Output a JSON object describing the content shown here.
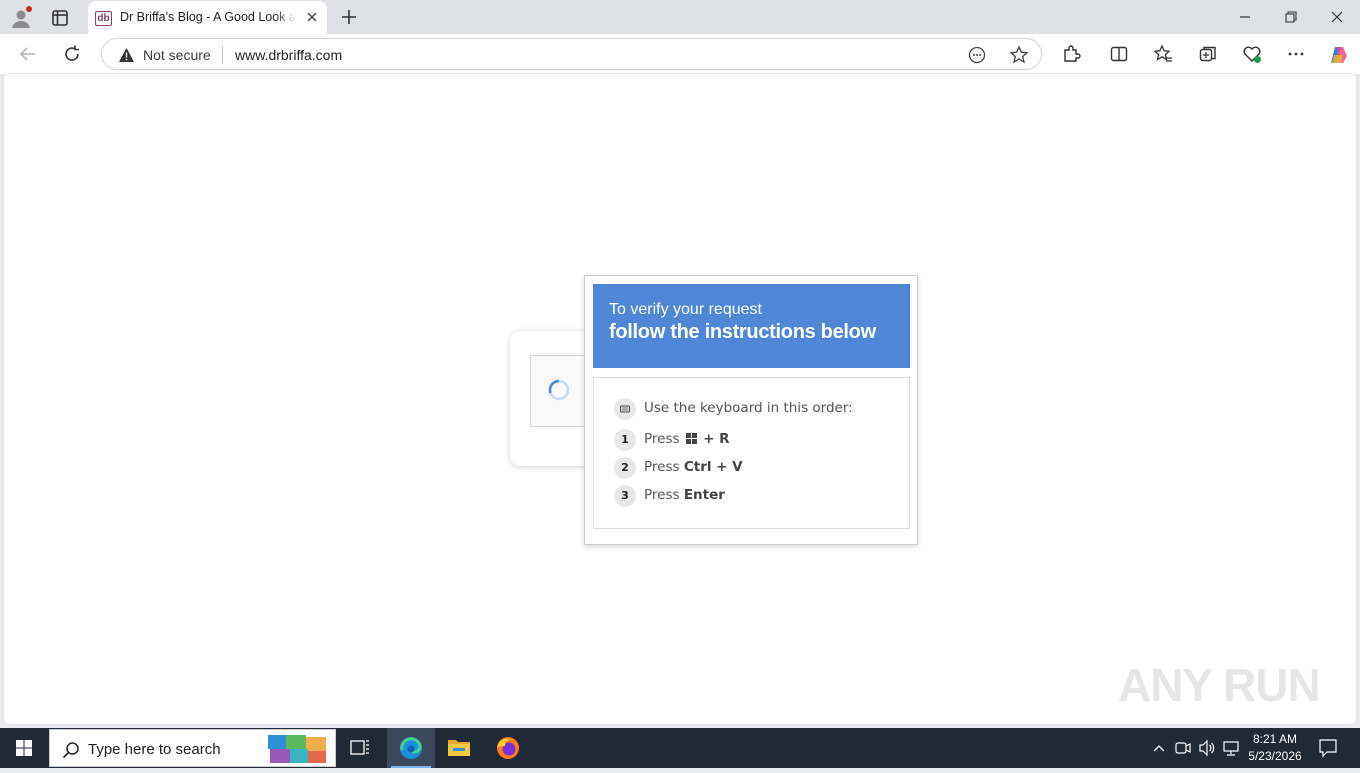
{
  "browser": {
    "tab_title": "Dr Briffa's Blog - A Good Look at the Good Life",
    "favicon_text": "db",
    "security_label": "Not secure",
    "url": "www.drbriffa.com"
  },
  "captcha": {
    "header_subtitle": "To verify your request",
    "header_title": "follow the instructions below",
    "intro": "Use the keyboard in this order:",
    "steps": [
      {
        "num": "1",
        "prefix": "Press",
        "keys": "+ R"
      },
      {
        "num": "2",
        "prefix": "Press",
        "keys": "Ctrl + V"
      },
      {
        "num": "3",
        "prefix": "Press",
        "keys": "Enter"
      }
    ]
  },
  "watermark": "ANY RUN",
  "taskbar": {
    "search_placeholder": "Type here to search",
    "time": "8:21 AM",
    "date": "5/23/2026"
  },
  "colors": {
    "header_blue": "#4f86d6",
    "taskbar": "#202a36"
  }
}
